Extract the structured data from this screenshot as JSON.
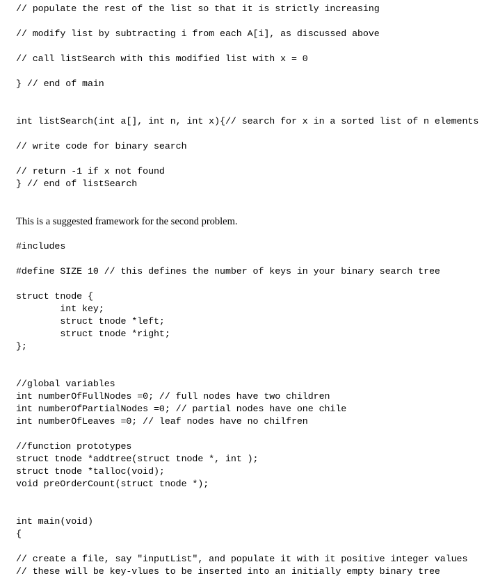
{
  "document": {
    "kind": "code-assignment-framework",
    "background_color": "#ffffff",
    "text_color": "#000000",
    "blocks": [
      {
        "id": "comment-populate",
        "style": "code",
        "lines": [
          "// populate the rest of the list so that it is strictly increasing"
        ]
      },
      {
        "id": "comment-modify",
        "style": "code",
        "lines": [
          "// modify list by subtracting i from each A[i], as discussed above"
        ]
      },
      {
        "id": "comment-call-listsearch",
        "style": "code",
        "lines": [
          "// call listSearch with this modified list with x = 0"
        ]
      },
      {
        "id": "end-of-main",
        "style": "code",
        "lines": [
          "} // end of main"
        ]
      },
      {
        "id": "listsearch-signature",
        "style": "code",
        "lines": [
          "int listSearch(int a[], int n, int x){// search for x in a sorted list of n elements"
        ]
      },
      {
        "id": "comment-write-binary-search",
        "style": "code",
        "lines": [
          "// write code for binary search"
        ]
      },
      {
        "id": "listsearch-return-and-end",
        "style": "code",
        "lines": [
          "// return -1 if x not found",
          "} // end of listSearch"
        ]
      },
      {
        "id": "prose-suggested-framework",
        "style": "prose",
        "lines": [
          "This is a suggested framework for the second problem."
        ]
      },
      {
        "id": "includes",
        "style": "code",
        "lines": [
          "#includes"
        ]
      },
      {
        "id": "define-size",
        "style": "code",
        "lines": [
          "#define SIZE 10 // this defines the number of keys in your binary search tree"
        ]
      },
      {
        "id": "struct-tnode",
        "style": "code",
        "lines": [
          "struct tnode {",
          "        int key;",
          "        struct tnode *left;",
          "        struct tnode *right;",
          "};"
        ]
      },
      {
        "id": "global-variables",
        "style": "code",
        "lines": [
          "//global variables",
          "int numberOfFullNodes =0; // full nodes have two children",
          "int numberOfPartialNodes =0; // partial nodes have one chile",
          "int numberOfLeaves =0; // leaf nodes have no chilfren"
        ]
      },
      {
        "id": "function-prototypes",
        "style": "code",
        "lines": [
          "//function prototypes",
          "struct tnode *addtree(struct tnode *, int );",
          "struct tnode *talloc(void);",
          "void preOrderCount(struct tnode *);"
        ]
      },
      {
        "id": "main-header",
        "style": "code",
        "lines": [
          "int main(void)",
          "{"
        ]
      },
      {
        "id": "comment-create-file",
        "style": "code",
        "lines": [
          "// create a file, say \"inputList\", and populate it with it positive integer values",
          "// these will be key-vlues to be inserted into an initially empty binary tree"
        ]
      }
    ]
  }
}
